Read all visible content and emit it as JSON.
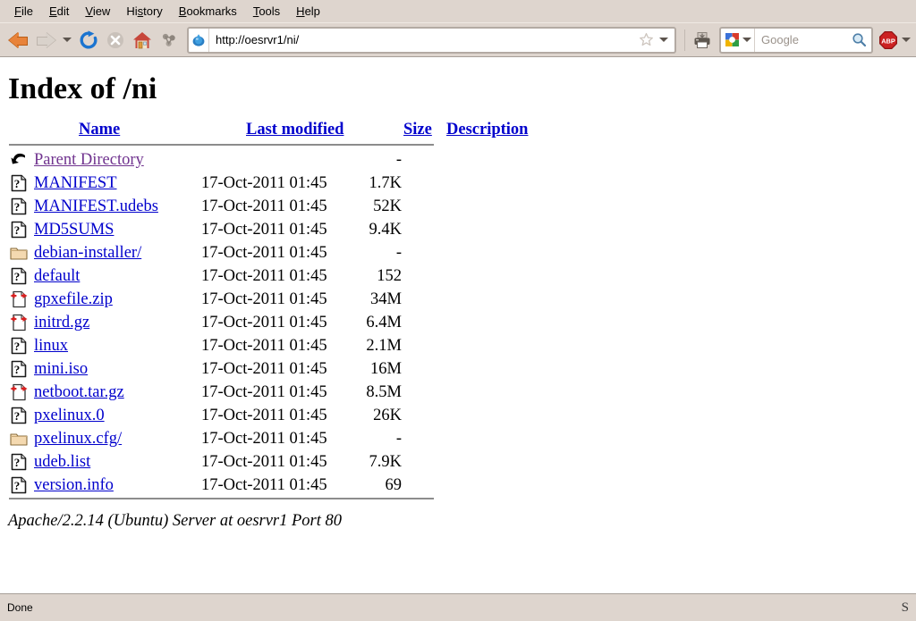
{
  "browser": {
    "menus": [
      {
        "label": "File",
        "accel": "F"
      },
      {
        "label": "Edit",
        "accel": "E"
      },
      {
        "label": "View",
        "accel": "V"
      },
      {
        "label": "History",
        "accel": "s"
      },
      {
        "label": "Bookmarks",
        "accel": "B"
      },
      {
        "label": "Tools",
        "accel": "T"
      },
      {
        "label": "Help",
        "accel": "H"
      }
    ],
    "toolbar": {
      "back_title": "Back",
      "forward_title": "Forward",
      "history_title": "History dropdown",
      "reload_title": "Reload",
      "stop_title": "Stop",
      "home_title": "Home",
      "feed_title": "Subscribe",
      "print_title": "Print"
    },
    "address": {
      "url": "http://oesrvr1/ni/",
      "favicon": "droplet-icon",
      "star": "bookmark-star-icon",
      "dropdown": "chevron-down-icon"
    },
    "search": {
      "engine": "Google",
      "placeholder": "Google",
      "value": "",
      "engine_icon": "google-logo-icon",
      "go_icon": "magnifier-icon"
    },
    "adblock": {
      "label": "ABP",
      "dropdown": "chevron-down-icon"
    },
    "status": {
      "text": "Done",
      "right_glyph": "S"
    }
  },
  "page": {
    "title": "Index of /ni",
    "columns": {
      "name": "Name",
      "last_modified": "Last modified",
      "size": "Size",
      "description": "Description"
    },
    "rows": [
      {
        "icon": "parent-directory-icon",
        "name": "Parent Directory",
        "visited": true,
        "date": "",
        "size": "-",
        "desc": ""
      },
      {
        "icon": "unknown-file-icon",
        "name": "MANIFEST",
        "visited": false,
        "date": "17-Oct-2011 01:45",
        "size": "1.7K",
        "desc": ""
      },
      {
        "icon": "unknown-file-icon",
        "name": "MANIFEST.udebs",
        "visited": false,
        "date": "17-Oct-2011 01:45",
        "size": "52K",
        "desc": ""
      },
      {
        "icon": "unknown-file-icon",
        "name": "MD5SUMS",
        "visited": false,
        "date": "17-Oct-2011 01:45",
        "size": "9.4K",
        "desc": ""
      },
      {
        "icon": "folder-icon",
        "name": "debian-installer/",
        "visited": false,
        "date": "17-Oct-2011 01:45",
        "size": "-",
        "desc": ""
      },
      {
        "icon": "unknown-file-icon",
        "name": "default",
        "visited": false,
        "date": "17-Oct-2011 01:45",
        "size": "152",
        "desc": ""
      },
      {
        "icon": "compressed-file-icon",
        "name": "gpxefile.zip",
        "visited": false,
        "date": "17-Oct-2011 01:45",
        "size": "34M",
        "desc": ""
      },
      {
        "icon": "compressed-file-icon",
        "name": "initrd.gz",
        "visited": false,
        "date": "17-Oct-2011 01:45",
        "size": "6.4M",
        "desc": ""
      },
      {
        "icon": "unknown-file-icon",
        "name": "linux",
        "visited": false,
        "date": "17-Oct-2011 01:45",
        "size": "2.1M",
        "desc": ""
      },
      {
        "icon": "unknown-file-icon",
        "name": "mini.iso",
        "visited": false,
        "date": "17-Oct-2011 01:45",
        "size": "16M",
        "desc": ""
      },
      {
        "icon": "compressed-file-icon",
        "name": "netboot.tar.gz",
        "visited": false,
        "date": "17-Oct-2011 01:45",
        "size": "8.5M",
        "desc": ""
      },
      {
        "icon": "unknown-file-icon",
        "name": "pxelinux.0",
        "visited": false,
        "date": "17-Oct-2011 01:45",
        "size": "26K",
        "desc": ""
      },
      {
        "icon": "folder-icon",
        "name": "pxelinux.cfg/",
        "visited": false,
        "date": "17-Oct-2011 01:45",
        "size": "-",
        "desc": ""
      },
      {
        "icon": "unknown-file-icon",
        "name": "udeb.list",
        "visited": false,
        "date": "17-Oct-2011 01:45",
        "size": "7.9K",
        "desc": ""
      },
      {
        "icon": "unknown-file-icon",
        "name": "version.info",
        "visited": false,
        "date": "17-Oct-2011 01:45",
        "size": "69",
        "desc": ""
      }
    ],
    "footer": "Apache/2.2.14 (Ubuntu) Server at oesrvr1 Port 80"
  },
  "colors": {
    "chrome": "#ded5ce",
    "link": "#0000cc",
    "visited_link": "#70338f",
    "accent_orange": "#e8833a",
    "abp_red": "#cc2222"
  }
}
